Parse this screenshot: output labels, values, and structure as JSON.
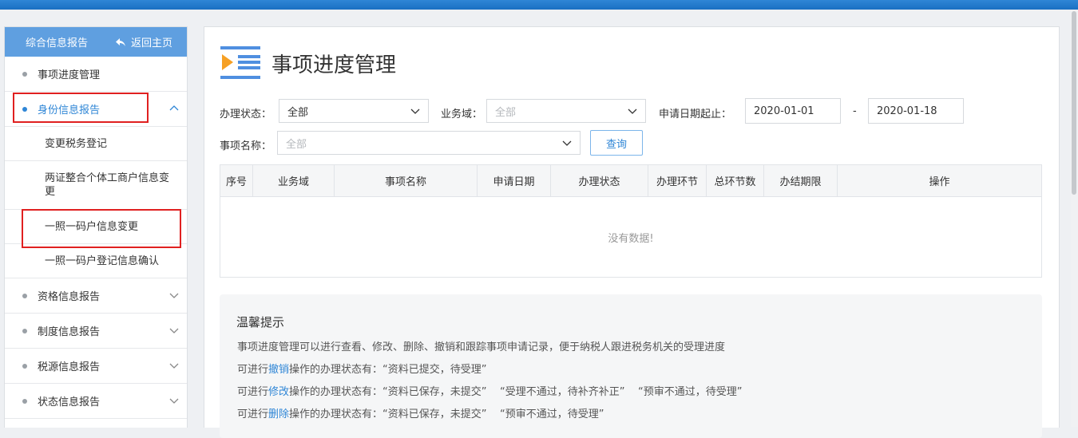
{
  "sidebar": {
    "title": "综合信息报告",
    "back_label": "返回主页",
    "items": [
      {
        "label": "事项进度管理"
      },
      {
        "label": "身份信息报告"
      },
      {
        "label": "资格信息报告"
      },
      {
        "label": "制度信息报告"
      },
      {
        "label": "税源信息报告"
      },
      {
        "label": "状态信息报告"
      }
    ],
    "subitems": [
      {
        "label": "变更税务登记"
      },
      {
        "label": "两证整合个体工商户信息变更"
      },
      {
        "label": "一照一码户信息变更"
      },
      {
        "label": "一照一码户登记信息确认"
      }
    ]
  },
  "page": {
    "title": "事项进度管理"
  },
  "filters": {
    "status_label": "办理状态：",
    "status_value": "全部",
    "domain_label": "业务域：",
    "domain_placeholder": "全部",
    "date_label": "申请日期起止：",
    "date_from": "2020-01-01",
    "date_sep": "-",
    "date_to": "2020-01-18",
    "name_label": "事项名称：",
    "name_placeholder": "全部",
    "query_button": "查询"
  },
  "table": {
    "columns": [
      "序号",
      "业务域",
      "事项名称",
      "申请日期",
      "办理状态",
      "办理环节",
      "总环节数",
      "办结期限",
      "操作"
    ],
    "empty_text": "没有数据!"
  },
  "tips": {
    "title": "温馨提示",
    "line1": "事项进度管理可以进行查看、修改、删除、撤销和跟踪事项申请记录，便于纳税人跟进税务机关的受理进度",
    "line2_prefix": "可进行",
    "line2_link": "撤销",
    "line2_suffix": "操作的办理状态有：“资料已提交，待受理”",
    "line3_prefix": "可进行",
    "line3_link": "修改",
    "line3_suffix": "操作的办理状态有：“资料已保存，未提交”    “受理不通过，待补齐补正”    “预审不通过，待受理”",
    "line4_prefix": "可进行",
    "line4_link": "删除",
    "line4_suffix": "操作的办理状态有：“资料已保存，未提交”    “预审不通过，待受理”"
  },
  "colors": {
    "accent": "#2f86d6",
    "sidebar_header": "#5f9fe0",
    "highlight_box": "#e02020"
  }
}
